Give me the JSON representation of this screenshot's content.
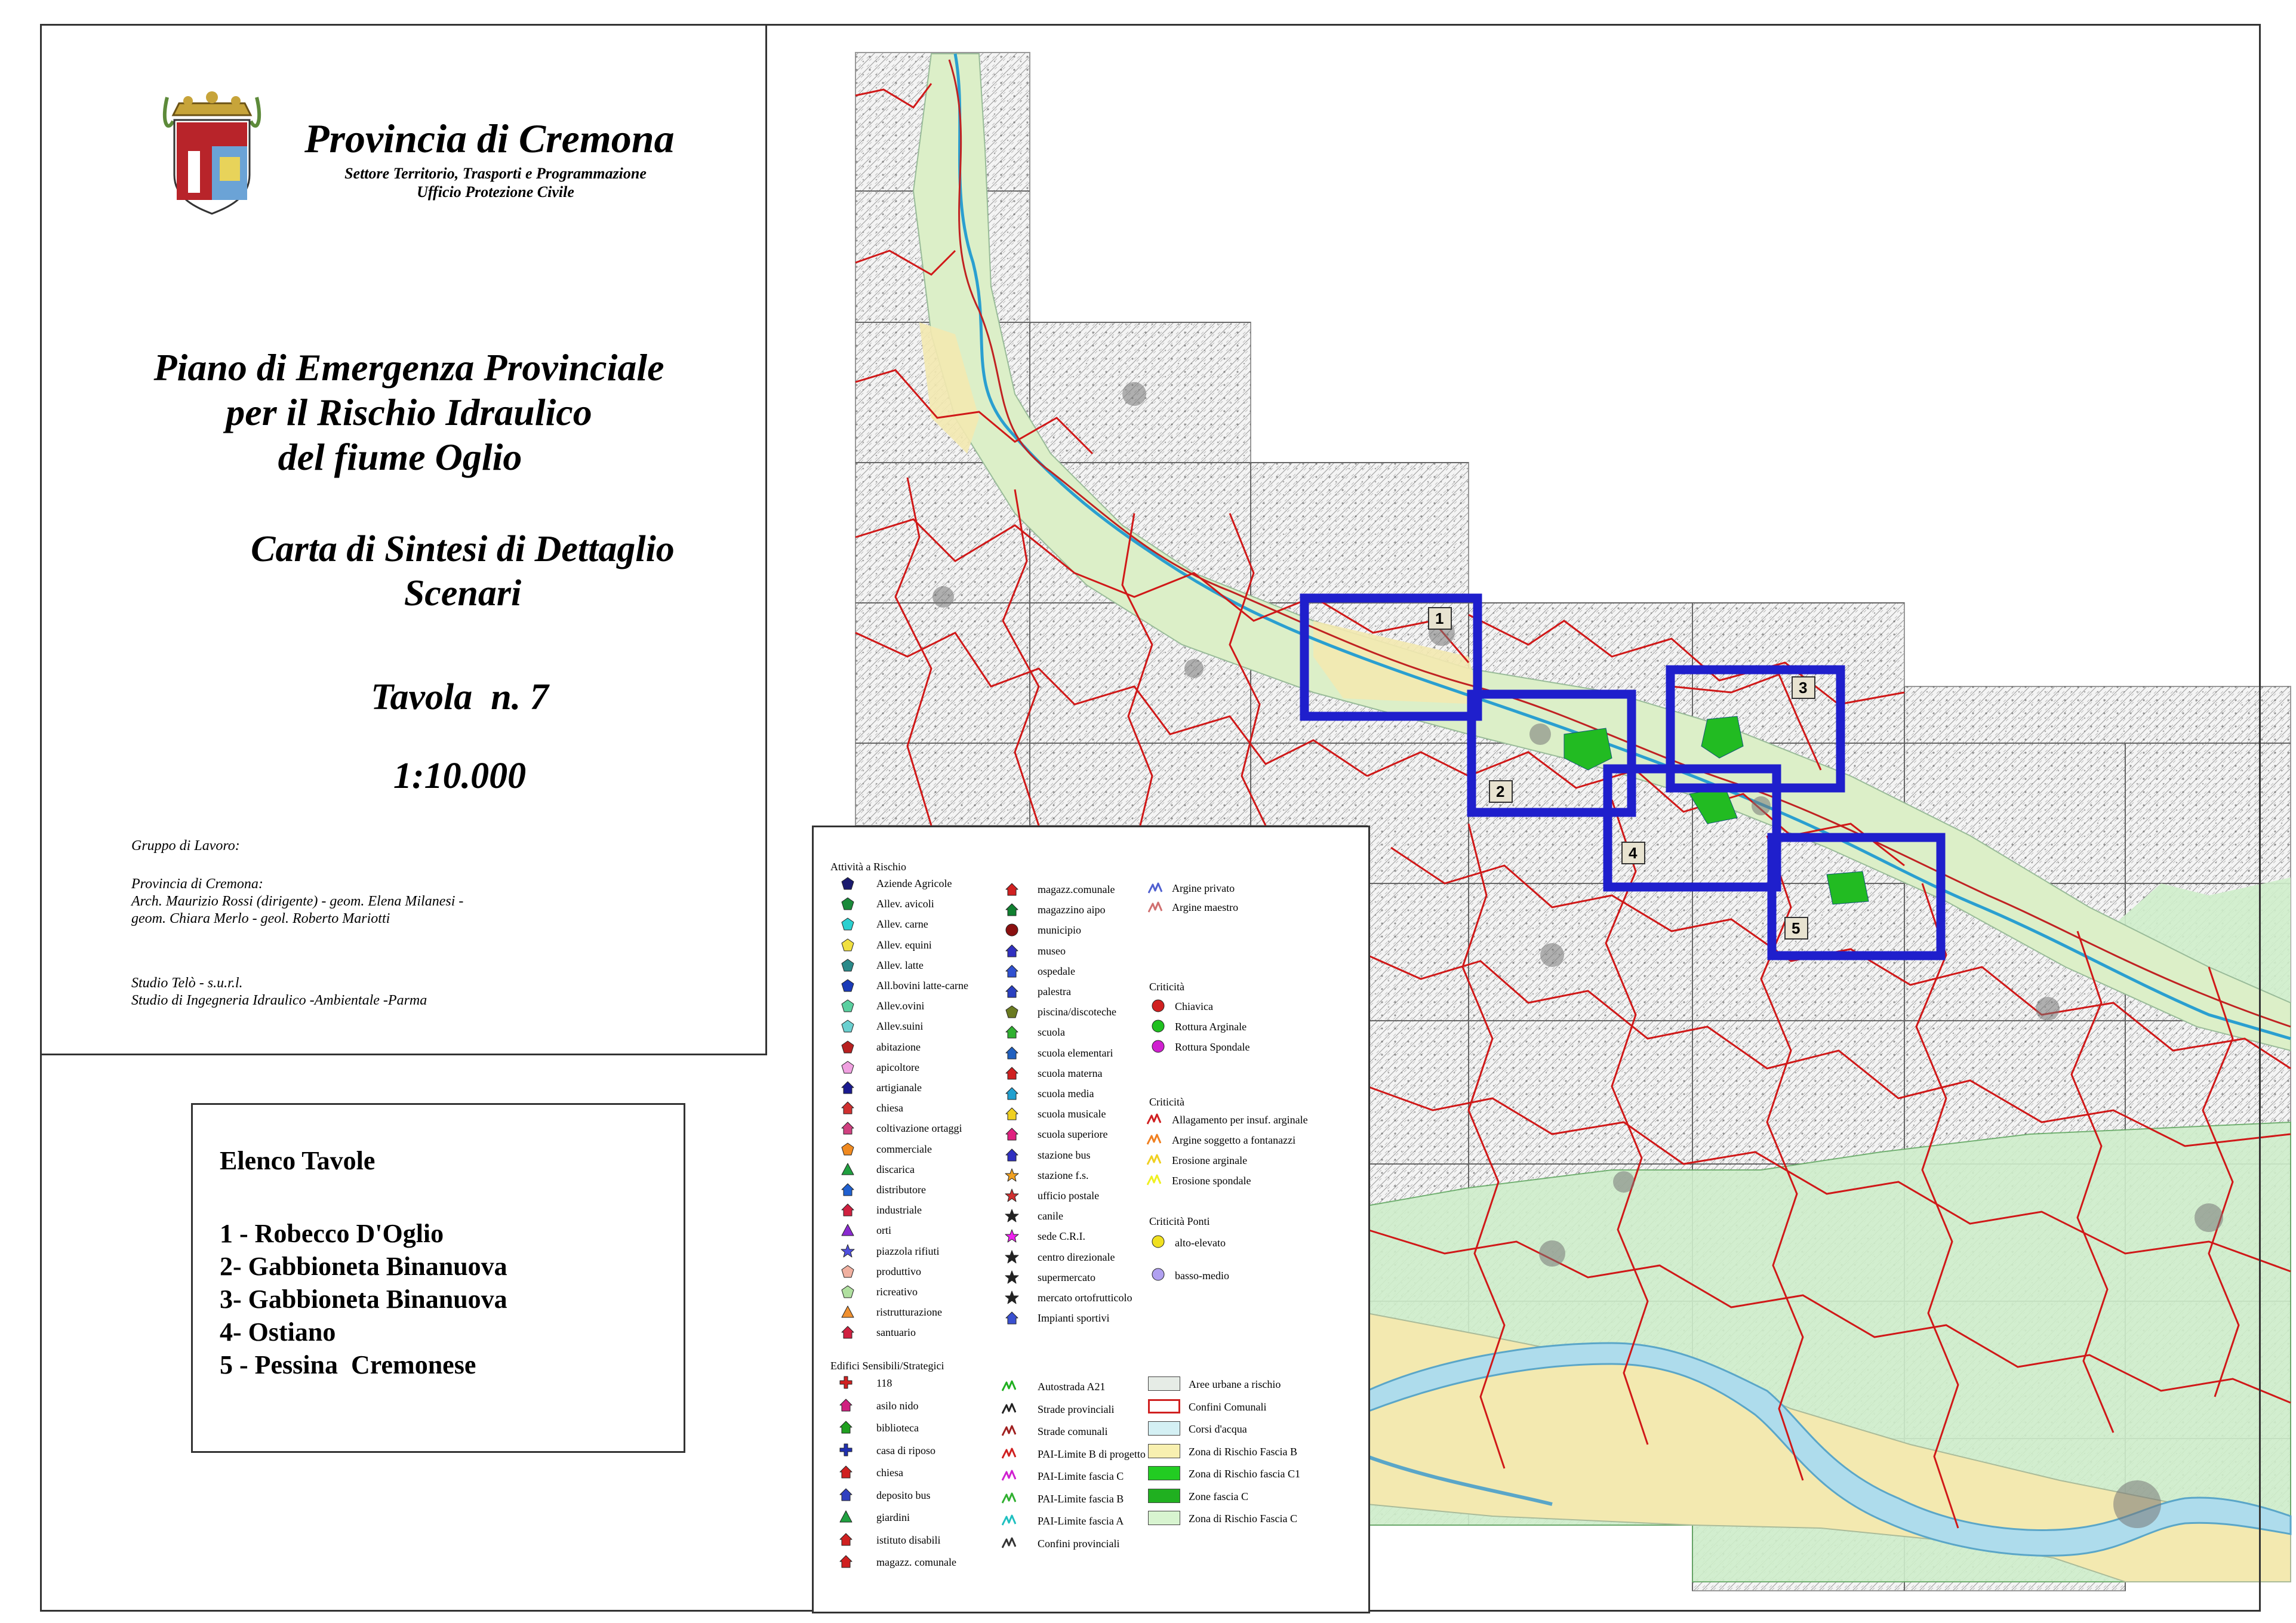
{
  "header": {
    "province": "Provincia di Cremona",
    "sector_line1": "Settore Territorio, Trasporti e Programmazione",
    "sector_line2": "Ufficio Protezione Civile"
  },
  "title": {
    "line1": "Piano di Emergenza Provinciale",
    "line2": "per il Rischio Idraulico",
    "line3": "del fiume Oglio",
    "sub1": "Carta di Sintesi di Dettaglio",
    "sub2": "Scenari",
    "tavola": "Tavola  n. 7",
    "scale": "1:10.000"
  },
  "credits": {
    "gruppo": "Gruppo di Lavoro:",
    "provincia": "Provincia di Cremona:",
    "people1": "Arch. Maurizio Rossi (dirigente) - geom. Elena Milanesi -",
    "people2": "geom. Chiara Merlo - geol. Roberto Mariotti",
    "studio1": "Studio Telò - s.u.r.l.",
    "studio2": "Studio di Ingegneria Idraulico -Ambientale -Parma"
  },
  "elenco": {
    "title": "Elenco Tavole",
    "items": [
      "1 - Robecco D'Oglio",
      "2- Gabbioneta Binanuova",
      "3- Gabbioneta Binanuova",
      "4- Ostiano",
      "5 - Pessina  Cremonese"
    ]
  },
  "map": {
    "tiles": [
      "1",
      "2",
      "3",
      "4",
      "5"
    ],
    "colors": {
      "tile_border": "#1f1fcc",
      "boundary": "#d01818",
      "fascia_b": "#f3e9b0",
      "fascia_c": "#cfeecb",
      "fascia_c1": "#22bb22",
      "water": "#aedcec"
    }
  },
  "legend": {
    "col1_head": "Attività a Rischio",
    "col1": [
      "Aziende Agricole",
      "Allev. avicoli",
      "Allev. carne",
      "Allev. equini",
      "Allev. latte",
      "All.bovini latte-carne",
      "Allev.ovini",
      "Allev.suini",
      "abitazione",
      "apicoltore",
      "artigianale",
      "chiesa",
      "coltivazione ortaggi",
      "commerciale",
      "discarica",
      "distributore",
      "industriale",
      "orti",
      "piazzola rifiuti",
      "produttivo",
      "ricreativo",
      "ristrutturazione",
      "santuario"
    ],
    "col2": [
      "magazz.comunale",
      "magazzino aipo",
      "municipio",
      "museo",
      "ospedale",
      "palestra",
      "piscina/discoteche",
      "scuola",
      "scuola elementari",
      "scuola materna",
      "scuola media",
      "scuola musicale",
      "scuola superiore",
      "stazione bus",
      "stazione f.s.",
      "ufficio postale",
      "canile",
      "sede C.R.I.",
      "centro direzionale",
      "supermercato",
      "mercato ortofrutticolo",
      "Impianti sportivi"
    ],
    "argini": [
      "Argine privato",
      "Argine maestro"
    ],
    "crit1_head": "Criticità",
    "crit1": [
      "Chiavica",
      "Rottura Arginale",
      "Rottura Spondale"
    ],
    "crit2_head": "Criticità",
    "crit2": [
      "Allagamento per insuf. arginale",
      "Argine soggetto a fontanazzi",
      "Erosione arginale",
      "Erosione spondale"
    ],
    "ponti_head": "Criticità Ponti",
    "ponti": [
      "alto-elevato",
      "basso-medio"
    ],
    "edifici_head": "Edifici Sensibili/Strategici",
    "edifici": [
      "118",
      "asilo nido",
      "biblioteca",
      "casa di riposo",
      "chiesa",
      "deposito bus",
      "giardini",
      "istituto disabili",
      "magazz. comunale"
    ],
    "linee": [
      "Autostrada A21",
      "Strade provinciali",
      "Strade comunali",
      "PAI-Limite B di progetto",
      "PAI-Limite fascia C",
      "PAI-Limite fascia B",
      "PAI-Limite fascia A",
      "Confini provinciali"
    ],
    "aree": [
      "Aree urbane a rischio",
      "Confini Comunali",
      "Corsi d'acqua",
      "Zona di Rischio Fascia B",
      "Zona di Rischio fascia C1",
      "Zone fascia C",
      "Zona di Rischio Fascia C"
    ]
  }
}
